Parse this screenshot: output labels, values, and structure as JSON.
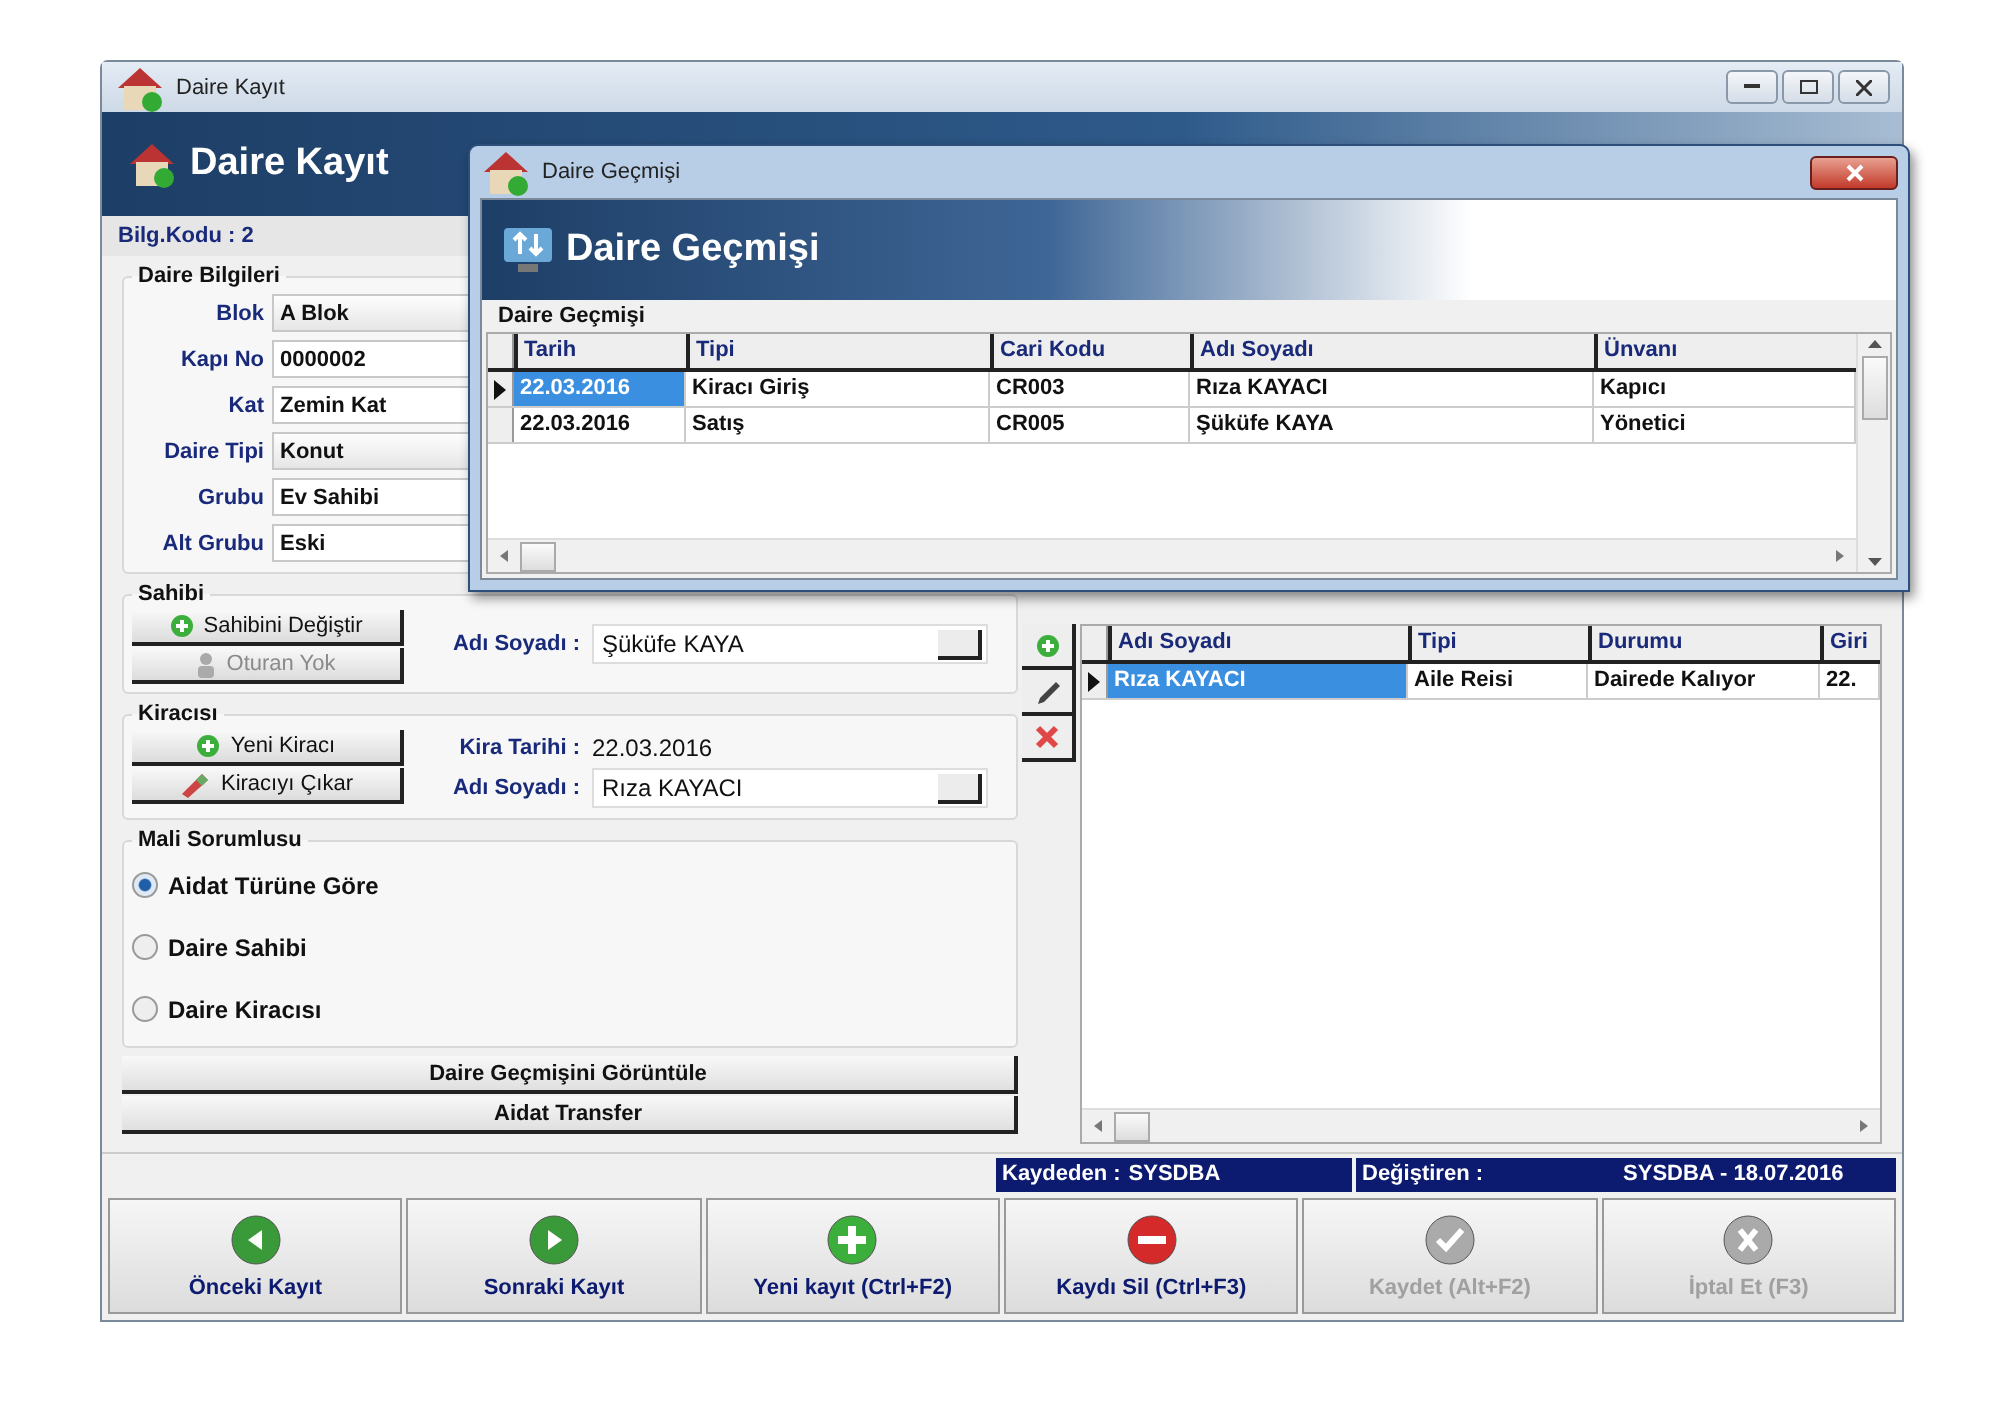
{
  "main_window": {
    "title": "Daire Kayıt",
    "header": "Daire Kayıt",
    "info": "Bilg.Kodu : 2"
  },
  "daire_bilgileri": {
    "title": "Daire Bilgileri",
    "fields": [
      {
        "label": "Blok",
        "value": "A Blok",
        "kind": "combo"
      },
      {
        "label": "Kapı No",
        "value": "0000002",
        "kind": "text"
      },
      {
        "label": "Kat",
        "value": "Zemin Kat",
        "kind": "dropdown"
      },
      {
        "label": "Daire Tipi",
        "value": "Konut",
        "kind": "combo"
      },
      {
        "label": "Grubu",
        "value": "Ev Sahibi",
        "kind": "text"
      },
      {
        "label": "Alt Grubu",
        "value": "Eski",
        "kind": "text"
      }
    ]
  },
  "sahibi": {
    "title": "Sahibi",
    "buttons": [
      {
        "label": "Sahibini Değiştir",
        "kind": "change",
        "disabled": false
      },
      {
        "label": "Oturan Yok",
        "kind": "person",
        "disabled": true
      }
    ],
    "name_label": "Adı Soyadı :",
    "name": "Şüküfe KAYA"
  },
  "kiracisi": {
    "title": "Kiracısı",
    "buttons": [
      {
        "label": "Yeni Kiracı",
        "kind": "add",
        "disabled": false
      },
      {
        "label": "Kiracıyı Çıkar",
        "kind": "erase",
        "disabled": false
      }
    ],
    "date_label": "Kira Tarihi :",
    "date": "22.03.2016",
    "name_label": "Adı Soyadı :",
    "name": "Rıza KAYACI"
  },
  "mali_sorumlusu": {
    "title": "Mali Sorumlusu",
    "options": [
      {
        "label": "Aidat Türüne Göre",
        "selected": true
      },
      {
        "label": "Daire Sahibi",
        "selected": false
      },
      {
        "label": "Daire Kiracısı",
        "selected": false
      }
    ]
  },
  "actions": [
    "Daire Geçmişini Görüntüle",
    "Aidat Transfer"
  ],
  "sakinler": {
    "tools": [
      {
        "kind": "add"
      },
      {
        "kind": "edit"
      },
      {
        "kind": "delete"
      }
    ],
    "columns": [
      "Adı Soyadı",
      "Tipi",
      "Durumu",
      "Giri"
    ],
    "rows": [
      {
        "cells": [
          "Rıza KAYACI",
          "Aile Reisi",
          "Dairede Kalıyor",
          "22."
        ],
        "current": true
      }
    ]
  },
  "status": [
    {
      "label": "Kaydeden :",
      "value": "SYSDBA"
    },
    {
      "label": "Değiştiren :",
      "value": "SYSDBA - 18.07.2016"
    }
  ],
  "toolbar": [
    {
      "label": "Önceki Kayıt",
      "kind": "prev",
      "disabled": false
    },
    {
      "label": "Sonraki Kayıt",
      "kind": "next",
      "disabled": false
    },
    {
      "label": "Yeni kayıt (Ctrl+F2)",
      "kind": "add",
      "disabled": false
    },
    {
      "label": "Kaydı Sil (Ctrl+F3)",
      "kind": "delete",
      "disabled": false
    },
    {
      "label": "Kaydet (Alt+F2)",
      "kind": "save",
      "disabled": true
    },
    {
      "label": "İptal Et (F3)",
      "kind": "cancel",
      "disabled": true
    }
  ],
  "dialog": {
    "title": "Daire Geçmişi",
    "header": "Daire Geçmişi",
    "section": "Daire Geçmişi",
    "columns": [
      "Tarih",
      "Tipi",
      "Cari Kodu",
      "Adı Soyadı",
      "Ünvanı"
    ],
    "rows": [
      {
        "cells": [
          "22.03.2016",
          "Kiracı Giriş",
          "CR003",
          "Rıza KAYACI",
          "Kapıcı"
        ],
        "current": true
      },
      {
        "cells": [
          "22.03.2016",
          "Satış",
          "CR005",
          "Şüküfe KAYA",
          "Yönetici"
        ],
        "current": false
      }
    ]
  }
}
